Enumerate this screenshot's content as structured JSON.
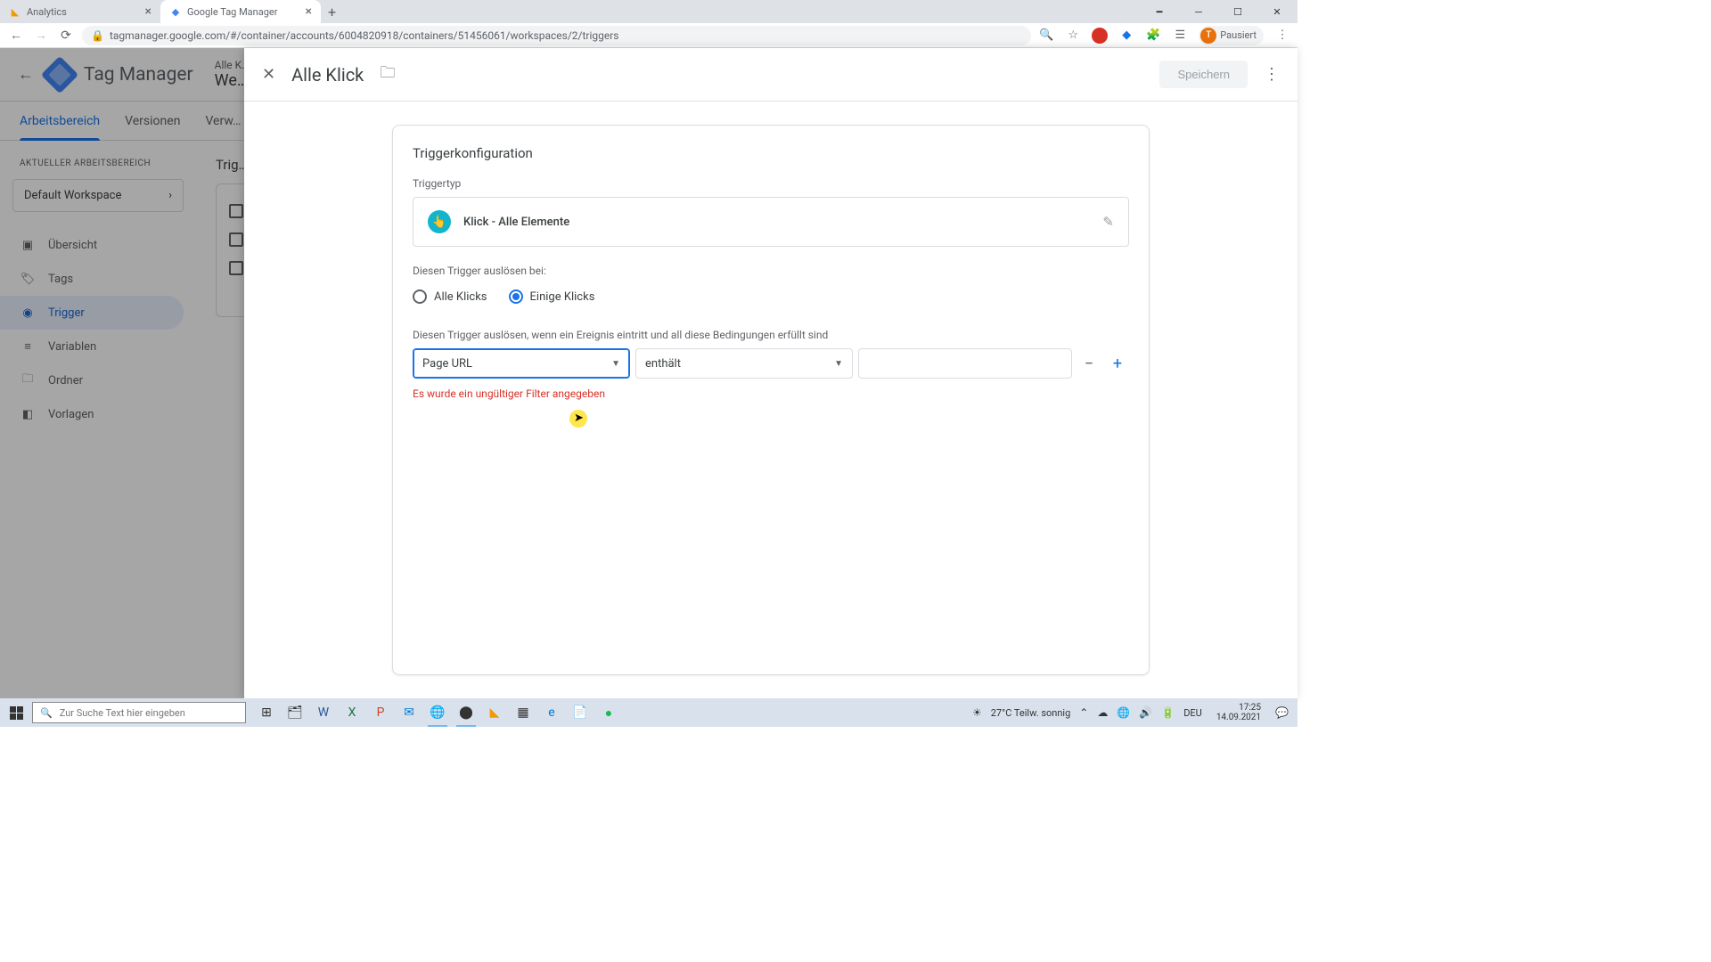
{
  "browser": {
    "tabs": [
      {
        "title": "Analytics",
        "favicon_color": "#f29900"
      },
      {
        "title": "Google Tag Manager",
        "favicon_color": "#4285f4"
      }
    ],
    "url": "tagmanager.google.com/#/container/accounts/6004820918/containers/51456061/workspaces/2/triggers",
    "profile": {
      "initial": "T",
      "status": "Pausiert"
    }
  },
  "gtm": {
    "app_name": "Tag Manager",
    "breadcrumb_line1": "Alle K…",
    "breadcrumb_line2": "We…",
    "tabs": [
      "Arbeitsbereich",
      "Versionen",
      "Verw…"
    ],
    "workspace_label": "AKTUELLER ARBEITSBEREICH",
    "workspace_name": "Default Workspace",
    "sidebar": [
      {
        "label": "Übersicht",
        "icon": "▣"
      },
      {
        "label": "Tags",
        "icon": "🏷"
      },
      {
        "label": "Trigger",
        "icon": "◉",
        "active": true
      },
      {
        "label": "Variablen",
        "icon": "≡"
      },
      {
        "label": "Ordner",
        "icon": "🗀"
      },
      {
        "label": "Vorlagen",
        "icon": "◧"
      }
    ],
    "content_header": "Trig…"
  },
  "panel": {
    "title": "Alle Klick",
    "save_label": "Speichern",
    "config_title": "Triggerkonfiguration",
    "type_label": "Triggertyp",
    "type_name": "Klick - Alle Elemente",
    "fire_label": "Diesen Trigger auslösen bei:",
    "radio1": "Alle Klicks",
    "radio2": "Einige Klicks",
    "condition_label": "Diesen Trigger auslösen, wenn ein Ereignis eintritt und all diese Bedingungen erfüllt sind",
    "select_variable": "Page URL",
    "select_operator": "enthält",
    "error": "Es wurde ein ungültiger Filter angegeben"
  },
  "taskbar": {
    "search_placeholder": "Zur Suche Text hier eingeben",
    "weather": "27°C  Teilw. sonnig",
    "lang": "DEU",
    "time": "17:25",
    "date": "14.09.2021"
  }
}
